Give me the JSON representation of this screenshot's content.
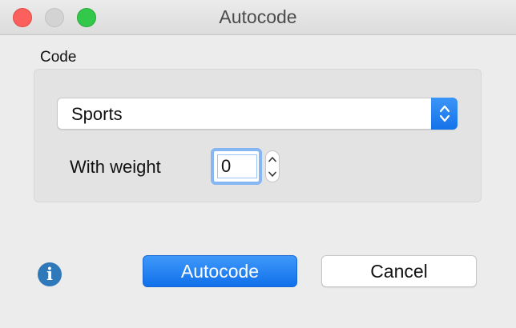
{
  "window": {
    "title": "Autocode"
  },
  "code_group": {
    "label": "Code",
    "selected_code": "Sports"
  },
  "weight": {
    "label": "With weight",
    "value": "0"
  },
  "buttons": {
    "autocode_label": "Autocode",
    "cancel_label": "Cancel"
  },
  "info_button": {
    "glyph": "i"
  },
  "colors": {
    "accent": "#1572e8",
    "close": "#fc605c",
    "zoom": "#34c84a",
    "info": "#2f78b9"
  }
}
